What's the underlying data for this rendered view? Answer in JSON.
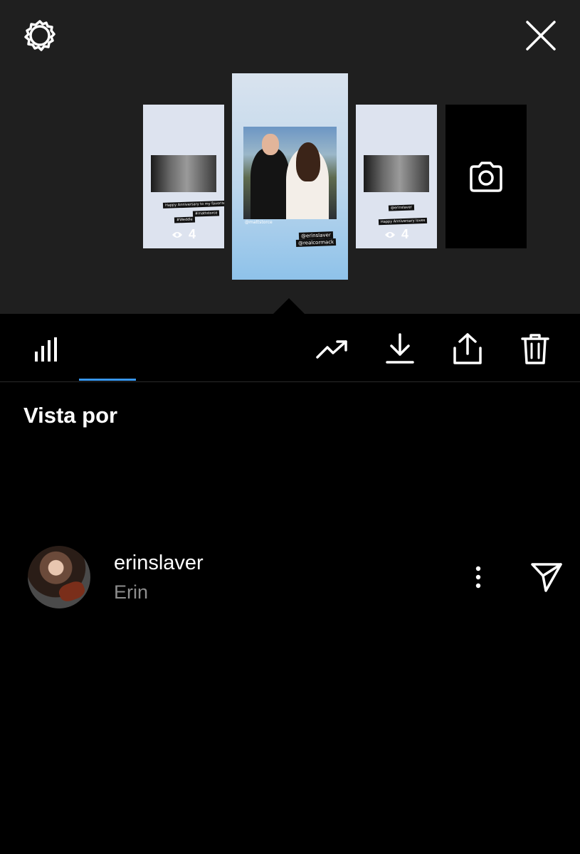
{
  "header": {
    "settings_icon": "gear-icon",
    "close_icon": "close-icon"
  },
  "stories": [
    {
      "stickers": [
        "Happy Anniversary to my favorite partner",
        "#mattstorce",
        "#Weddle"
      ],
      "views": "4"
    },
    {
      "caption": "@mattstorce",
      "stickers": [
        "@erinslaver",
        "@realcormack"
      ]
    },
    {
      "stickers": [
        "@erinslaver",
        "Happy Anniversary loves"
      ],
      "views": "4"
    }
  ],
  "toolbar": {
    "stats_icon": "bar-chart-icon",
    "promote_icon": "trending-up-icon",
    "download_icon": "download-icon",
    "share_icon": "share-icon",
    "delete_icon": "trash-icon",
    "accent": "#3897f0"
  },
  "section": {
    "title": "Vista por"
  },
  "viewers": [
    {
      "username": "erinslaver",
      "name": "Erin"
    }
  ],
  "colors": {
    "top_bg": "#1f1f1f",
    "bg": "#000000",
    "muted_text": "#8e8e8e"
  }
}
